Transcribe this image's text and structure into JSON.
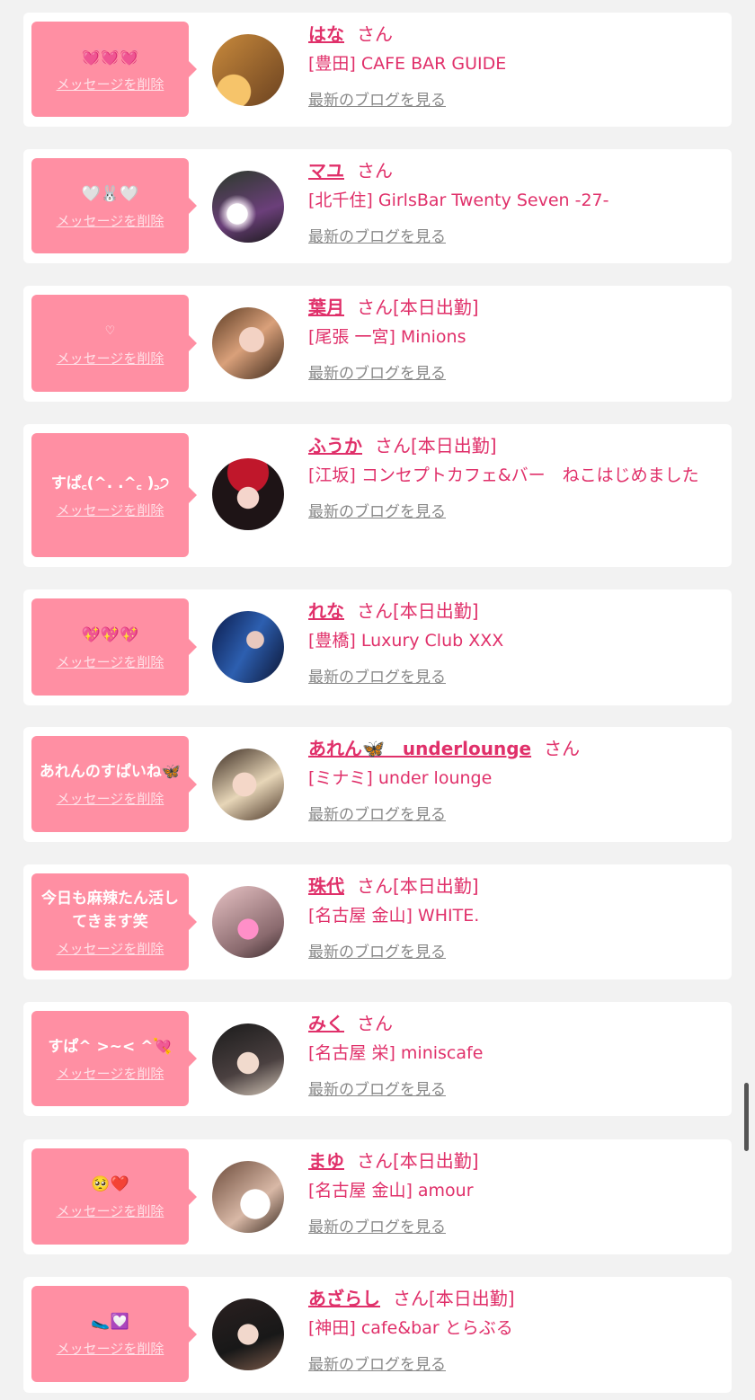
{
  "delete_label": "メッセージを削除",
  "blog_label": "最新のブログを見る",
  "san_label": "さん",
  "entries": [
    {
      "message": "💓💓💓",
      "name": "はな",
      "attendance": "",
      "shop": "[豊田] CAFE BAR GUIDE"
    },
    {
      "message": "🤍🐰🤍",
      "name": "マユ",
      "attendance": "",
      "shop": "[北千住] GirlsBar Twenty Seven -27-"
    },
    {
      "message": "♡",
      "name": "葉月",
      "attendance": "[本日出勤]",
      "shop": "[尾張 一宮] Minions"
    },
    {
      "message": "すぱ꜀(^. .^꜀ )꜆੭",
      "name": "ふうか",
      "attendance": "[本日出勤]",
      "shop": "[江坂] コンセプトカフェ&バー　ねこはじめました"
    },
    {
      "message": "💖💖💖",
      "name": "れな",
      "attendance": "[本日出勤]",
      "shop": "[豊橋] Luxury Club XXX"
    },
    {
      "message": "あれんのすぱいね🦋",
      "name": "あれん🦋　underlounge",
      "attendance": "",
      "shop": "[ミナミ] under lounge"
    },
    {
      "message": "今日も麻辣たん活してきます笑",
      "name": "珠代",
      "attendance": "[本日出勤]",
      "shop": "[名古屋 金山] WHITE."
    },
    {
      "message": "すぱ^ >~< ^💘",
      "name": "みく",
      "attendance": "",
      "shop": "[名古屋 栄] miniscafe"
    },
    {
      "message": "🥺❤️",
      "name": "まゆ",
      "attendance": "[本日出勤]",
      "shop": "[名古屋 金山] amour"
    },
    {
      "message": "🥿💟",
      "name": "あざらし",
      "attendance": "[本日出勤]",
      "shop": "[神田] cafe&bar とらぶる"
    }
  ]
}
